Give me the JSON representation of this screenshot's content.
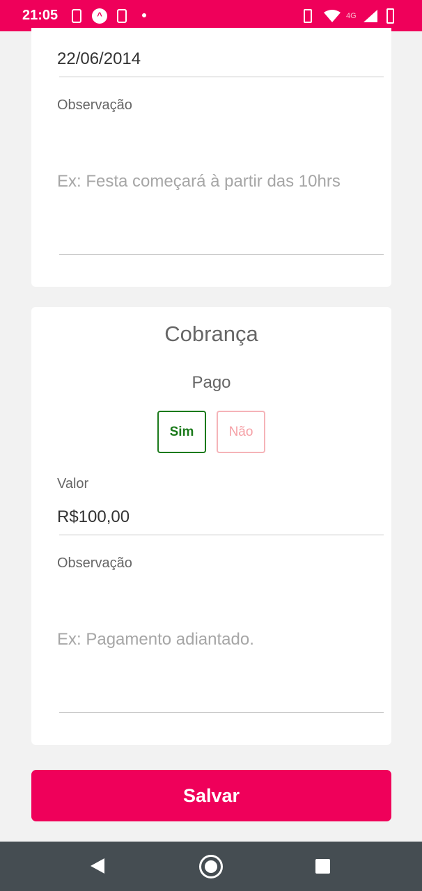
{
  "status_bar": {
    "time": "21:05",
    "network": "4G",
    "icons": [
      "phone-notification-icon",
      "app-notification-icon",
      "phone-notification-icon",
      "dot-icon",
      "vibrate-icon",
      "wifi-icon",
      "signal-icon",
      "battery-icon"
    ]
  },
  "event_card": {
    "date_value": "22/06/2014",
    "observation_label": "Observação",
    "observation_placeholder": "Ex: Festa começará à partir das 10hrs"
  },
  "billing_card": {
    "title": "Cobrança",
    "paid_label": "Pago",
    "paid_yes": "Sim",
    "paid_no": "Não",
    "paid_selected": "Sim",
    "value_label": "Valor",
    "value_value": "R$100,00",
    "observation_label": "Observação",
    "observation_placeholder": "Ex: Pagamento adiantado."
  },
  "actions": {
    "save_label": "Salvar"
  },
  "colors": {
    "primary": "#ef005a",
    "selected_green": "#1b7a1b",
    "unselected_pink": "#f5a0a6",
    "background": "#f2f2f2",
    "nav_bar": "#454d52"
  }
}
